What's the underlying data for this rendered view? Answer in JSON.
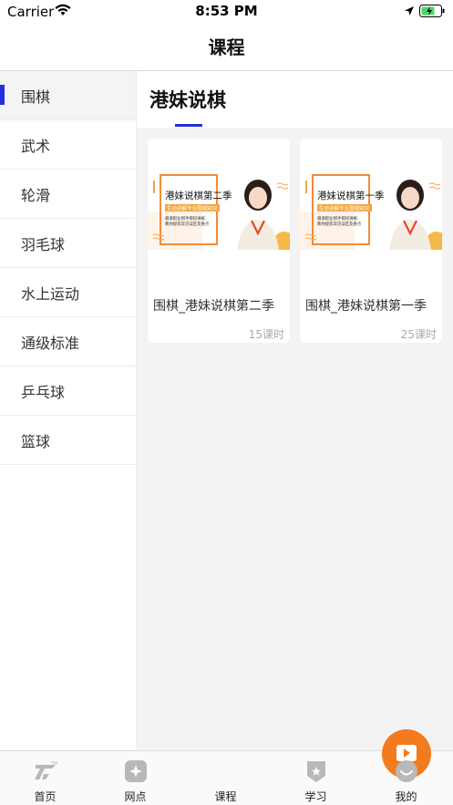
{
  "status_bar": {
    "carrier": "Carrier",
    "time": "8:53 PM"
  },
  "nav": {
    "title": "课程"
  },
  "sidebar": {
    "items": [
      {
        "label": "围棋",
        "active": true
      },
      {
        "label": "武术"
      },
      {
        "label": "轮滑"
      },
      {
        "label": "羽毛球"
      },
      {
        "label": "水上运动"
      },
      {
        "label": "通级标准"
      },
      {
        "label": "乒乓球"
      },
      {
        "label": "篮球"
      }
    ]
  },
  "main": {
    "section_title": "港妹说棋",
    "cards": [
      {
        "title": "围棋_港妹说棋第二季",
        "lessons": "15课时",
        "thumb": {
          "heading": "港妹说棋第二季",
          "tag": "生动讲解专业围棋知识",
          "line1": "邀请职业棋手授权讲解,",
          "line2": "教你提炼常见误区及重点"
        }
      },
      {
        "title": "围棋_港妹说棋第一季",
        "lessons": "25课时",
        "thumb": {
          "heading": "港妹说棋第一季",
          "tag": "生动讲解专业围棋知识",
          "line1": "邀请职业棋手授权讲解,",
          "line2": "教你提炼常见误区及重点"
        }
      }
    ]
  },
  "tab_bar": {
    "tabs": [
      {
        "label": "首页",
        "icon": "home-logo-icon"
      },
      {
        "label": "网点",
        "icon": "location-point-icon"
      },
      {
        "label": "课程",
        "icon": "play-icon",
        "active": true
      },
      {
        "label": "学习",
        "icon": "badge-icon"
      },
      {
        "label": "我的",
        "icon": "profile-smile-icon"
      }
    ]
  },
  "colors": {
    "accent": "#2330e0",
    "center_button": "#f47a1f",
    "card_label_bg": "#f5a53b"
  }
}
